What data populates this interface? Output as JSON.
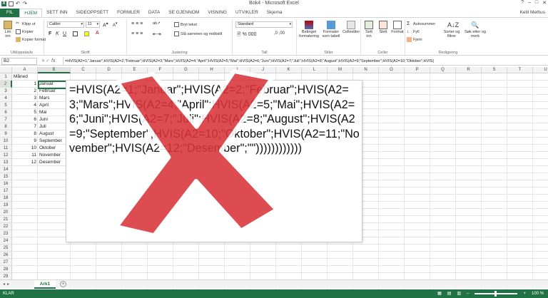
{
  "window": {
    "title": "Bok4 - Microsoft Excel",
    "user": "Ketil Melhus"
  },
  "tabs": [
    "FIL",
    "HJEM",
    "SETT INN",
    "SIDEOPPSETT",
    "FORMLER",
    "DATA",
    "SE GJENNOM",
    "VISNING",
    "UTVIKLER",
    "Skjema"
  ],
  "ribbon": {
    "clipboard": {
      "paste": "Lim inn",
      "cut": "Klipp ut",
      "copy": "Kopier",
      "format_painter": "Kopier format",
      "label": "Utklippstavle"
    },
    "font": {
      "name": "Calibri",
      "size": "11",
      "label": "Skrift"
    },
    "alignment": {
      "wrap": "Bryt tekst",
      "merge": "Slå sammen og midtstill",
      "label": "Justering"
    },
    "number": {
      "format": "Standard",
      "label": "Tall"
    },
    "styles": {
      "conditional": "Betinget formatering",
      "table": "Formater som tabell",
      "cell_styles": "Cellestiler",
      "label": "Stiler"
    },
    "cells": {
      "insert": "Sett inn",
      "delete": "Slett",
      "format": "Format",
      "label": "Celler"
    },
    "editing": {
      "autosum": "Autosummer",
      "fill": "Fyll",
      "clear": "Fjern",
      "sort": "Sorter og filtrer",
      "find": "Søk etter og merk",
      "label": "Redigering"
    }
  },
  "formula_bar": {
    "name_box": "B2",
    "fx": "fx",
    "formula": "=HVIS(A2=1;\"Januar\";HVIS(A2=2;\"Februar\";HVIS(A2=3;\"Mars\";HVIS(A2=4;\"April\";HVIS(A2=5;\"Mai\";HVIS(A2=6;\"Juni\";HVIS(A2=7;\"Juli\";HVIS(A2=8;\"August\";HVIS(A2=9;\"September\";HVIS(A2=10;\"Oktober\";HVIS("
  },
  "columns": [
    "A",
    "B",
    "C",
    "D",
    "E",
    "F",
    "G",
    "H",
    "I",
    "J",
    "K",
    "L",
    "M",
    "N",
    "O",
    "P",
    "Q",
    "R",
    "S",
    "T",
    "U"
  ],
  "header_cell": "Måned",
  "rows": [
    {
      "n": "1",
      "a": "",
      "b": ""
    },
    {
      "n": "2",
      "a": "1",
      "b": "Januar"
    },
    {
      "n": "3",
      "a": "2",
      "b": "Februar"
    },
    {
      "n": "4",
      "a": "3",
      "b": "Mars"
    },
    {
      "n": "5",
      "a": "4",
      "b": "April"
    },
    {
      "n": "6",
      "a": "5",
      "b": "Mai"
    },
    {
      "n": "7",
      "a": "6",
      "b": "Juni"
    },
    {
      "n": "8",
      "a": "7",
      "b": "Juli"
    },
    {
      "n": "9",
      "a": "8",
      "b": "August"
    },
    {
      "n": "10",
      "a": "9",
      "b": "September"
    },
    {
      "n": "11",
      "a": "10",
      "b": "Oktober"
    },
    {
      "n": "12",
      "a": "11",
      "b": "November"
    },
    {
      "n": "13",
      "a": "12",
      "b": "Desember"
    }
  ],
  "overlay": {
    "formula": "=HVIS(A2=1;\"Januar\";HVIS(A2=2;\"Februar\";HVIS(A2=3;\"Mars\";HVIS(A2=4;\"April\";HVIS(A2=5;\"Mai\";HVIS(A2=6;\"Juni\";HVIS(A2=7;\"Juli\";HVIS(A2=8;\"August\";HVIS(A2=9;\"September\";HVIS(A2=10;\"Oktober\";HVIS(A2=11;\"November\";HVIS(A2=12;\"Desember\";\"\"))))))))))))",
    "cross_color": "#d9343a"
  },
  "sheet_tab": "Ark1",
  "status": {
    "mode": "KLAR",
    "zoom": "100 %"
  },
  "colors": {
    "accent": "#217346"
  }
}
